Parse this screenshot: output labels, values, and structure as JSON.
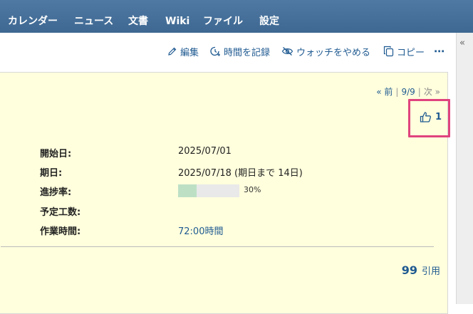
{
  "topnav": {
    "items": [
      "カレンダー",
      "ニュース",
      "文書",
      "Wiki",
      "ファイル",
      "設定"
    ]
  },
  "sidebar": {
    "toggle": "«"
  },
  "contextual": {
    "edit": "編集",
    "log_time": "時間を記録",
    "unwatch": "ウォッチをやめる",
    "copy": "コピー",
    "more": "⋯"
  },
  "issue": {
    "nav": {
      "prev": "« 前",
      "counter": "9/9",
      "next": "次 »"
    },
    "reaction": {
      "count": "1"
    },
    "attributes": {
      "start_date": {
        "label": "開始日:",
        "value": "2025/07/01"
      },
      "due_date": {
        "label": "期日:",
        "value": "2025/07/18 (期日まで 14日)"
      },
      "progress": {
        "label": "進捗率:",
        "percent": 30,
        "text": "30%"
      },
      "estimated_time": {
        "label": "予定工数:",
        "value": ""
      },
      "spent_time": {
        "label": "作業時間:",
        "value": "72:00時間"
      }
    },
    "quote": {
      "label": "引用",
      "icon": "99"
    }
  },
  "colors": {
    "nav_bg": "#4a74a0",
    "link": "#1f5a91",
    "issue_bg": "#ffffdd",
    "highlight": "#e0437e",
    "progress_fill": "#bde0c5"
  }
}
